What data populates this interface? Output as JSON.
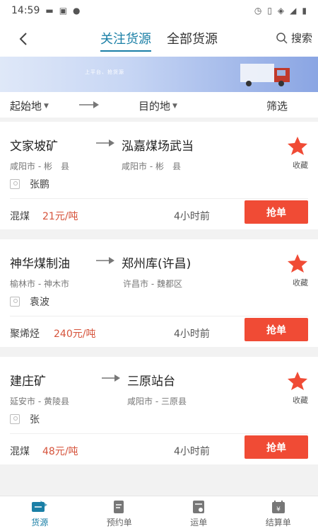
{
  "status": {
    "time": "14:59"
  },
  "nav": {
    "tabs": [
      "关注货源",
      "全部货源"
    ],
    "search_label": "搜索"
  },
  "banner": {
    "text": "上平台、抢货源"
  },
  "filter": {
    "origin": "起始地",
    "destination": "目的地",
    "filter": "筛选"
  },
  "cards": [
    {
      "from": "文家坡矿",
      "to": "泓嘉煤场武当",
      "from_sub": "咸阳市 - 彬　县",
      "to_sub": "咸阳市 - 彬　县",
      "person": "张鹏",
      "cargo": "混煤",
      "price": "21元/吨",
      "time": "4小时前",
      "collect": "收藏",
      "button": "抢单"
    },
    {
      "from": "神华煤制油",
      "to": "郑州库(许昌)",
      "from_sub": "榆林市 - 神木市",
      "to_sub": "许昌市 - 魏都区",
      "person": "袁波",
      "cargo": "聚烯烃",
      "price": "240元/吨",
      "time": "4小时前",
      "collect": "收藏",
      "button": "抢单"
    },
    {
      "from": "建庄矿",
      "to": "三原站台",
      "from_sub": "延安市 - 黄陵县",
      "to_sub": "咸阳市 - 三原县",
      "person": "张",
      "cargo": "混煤",
      "price": "48元/吨",
      "time": "4小时前",
      "collect": "收藏",
      "button": "抢单"
    }
  ],
  "bottom_nav": [
    "货源",
    "预约单",
    "运单",
    "结算单"
  ],
  "colors": {
    "accent": "#1a7fa6",
    "action": "#f04b35",
    "price": "#d6533b"
  }
}
